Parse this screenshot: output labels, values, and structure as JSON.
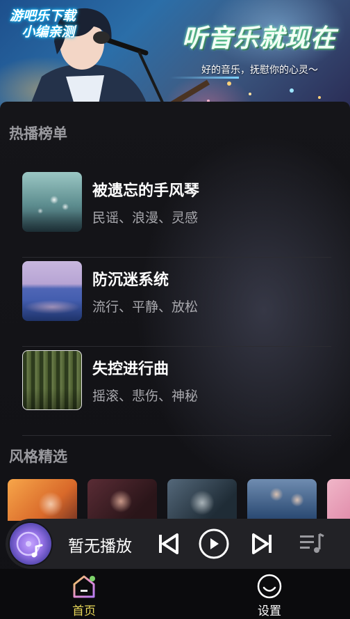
{
  "banner": {
    "badge_line1": "游吧乐下载",
    "badge_line2": "小编亲测",
    "title": "听音乐就现在",
    "subtitle": "好的音乐，抚慰你的心灵～"
  },
  "hot_charts": {
    "section_title": "热播榜单",
    "items": [
      {
        "name": "被遗忘的手风琴",
        "tags": "民谣、浪漫、灵感",
        "cover": "dandelion-forest-image"
      },
      {
        "name": "防沉迷系统",
        "tags": "流行、平静、放松",
        "cover": "purple-lake-image"
      },
      {
        "name": "失控进行曲",
        "tags": "摇滚、悲伤、神秘",
        "cover": "green-forest-image"
      }
    ]
  },
  "style_picks": {
    "section_title": "风格精选",
    "cards": [
      "singer-woman-orange",
      "woman-portrait-red",
      "man-portrait-dark",
      "couple-blue",
      "pink-partial"
    ]
  },
  "player": {
    "now_playing": "暂无播放",
    "icons": [
      "music-disc-icon",
      "previous-icon",
      "play-icon",
      "next-icon",
      "playlist-icon"
    ]
  },
  "nav": {
    "home_label": "首页",
    "settings_label": "设置",
    "active": "home",
    "active_color": "#e9d85a"
  }
}
